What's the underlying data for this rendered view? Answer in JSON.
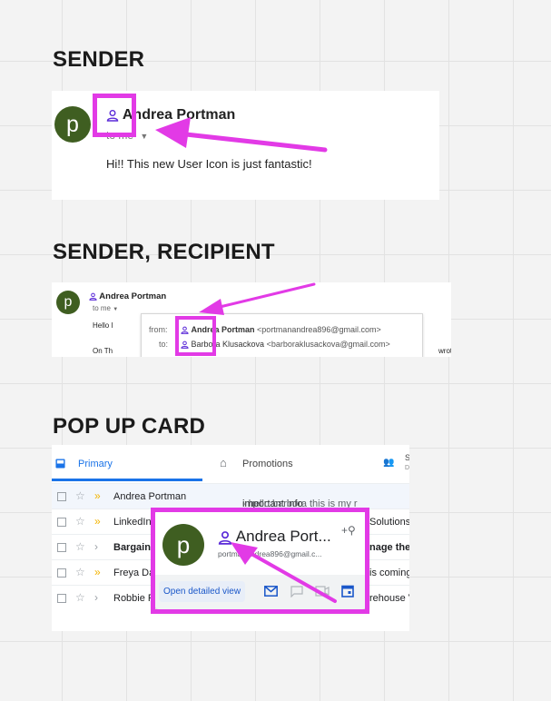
{
  "sections": {
    "sender": "SENDER",
    "sender_recipient": "SENDER, RECIPIENT",
    "popup_card": "POP UP CARD"
  },
  "sender_card": {
    "avatar_letter": "p",
    "sender_name": "Andrea Portman",
    "to_me": "to me",
    "message": "Hi!! This new User Icon is just fantastic!"
  },
  "recipient_card": {
    "avatar_letter": "p",
    "sender_name": "Andrea Portman",
    "to_me": "to me",
    "body_start": "Hello l",
    "body_line2": "On Th",
    "wrote": "wrote:",
    "details": {
      "from_label": "from:",
      "from_name": "Andrea Portman",
      "from_email": "<portmanandrea896@gmail.com>",
      "to_label": "to:",
      "to_name": "Barbora Klusackova",
      "to_email": "<barboraklusackova@gmail.com>"
    }
  },
  "inbox": {
    "tabs": [
      {
        "label": "Primary",
        "icon": "inbox-icon",
        "active": true
      },
      {
        "label": "Promotions",
        "icon": "tag-icon",
        "active": false
      },
      {
        "label": "S",
        "sub": "D",
        "icon": "people-icon",
        "active": false
      }
    ],
    "rows": [
      {
        "sender": "Andrea Portman",
        "subject": "important info",
        "snippet": " - hello barbora this is my r",
        "bold": false,
        "starred": false,
        "important": true
      },
      {
        "sender": "LinkedIn",
        "subject": "Solutions A",
        "snippet": "",
        "bold": false,
        "starred": false,
        "important": true
      },
      {
        "sender": "Bargain",
        "subject": "nage the",
        "snippet": "",
        "bold": true,
        "starred": false,
        "important": false
      },
      {
        "sender": "Freya Da",
        "subject": "is coming",
        "snippet": "",
        "bold": false,
        "starred": false,
        "important": true
      },
      {
        "sender": "Robbie P",
        "subject": "rehouse Ve",
        "snippet": "",
        "bold": false,
        "starred": false,
        "important": false
      }
    ],
    "popup": {
      "avatar_letter": "p",
      "name": "Andrea Port...",
      "email": "portmanandrea896@gmail.c...",
      "open_button": "Open detailed view",
      "actions": [
        "mail-icon",
        "chat-icon",
        "video-icon",
        "calendar-icon"
      ]
    }
  },
  "colors": {
    "highlight": "#e23ae6",
    "avatar": "#3f5e21",
    "user_icon": "#5b2bd8",
    "important_marker": "#f4b400",
    "primary_tab": "#1a73e8"
  }
}
